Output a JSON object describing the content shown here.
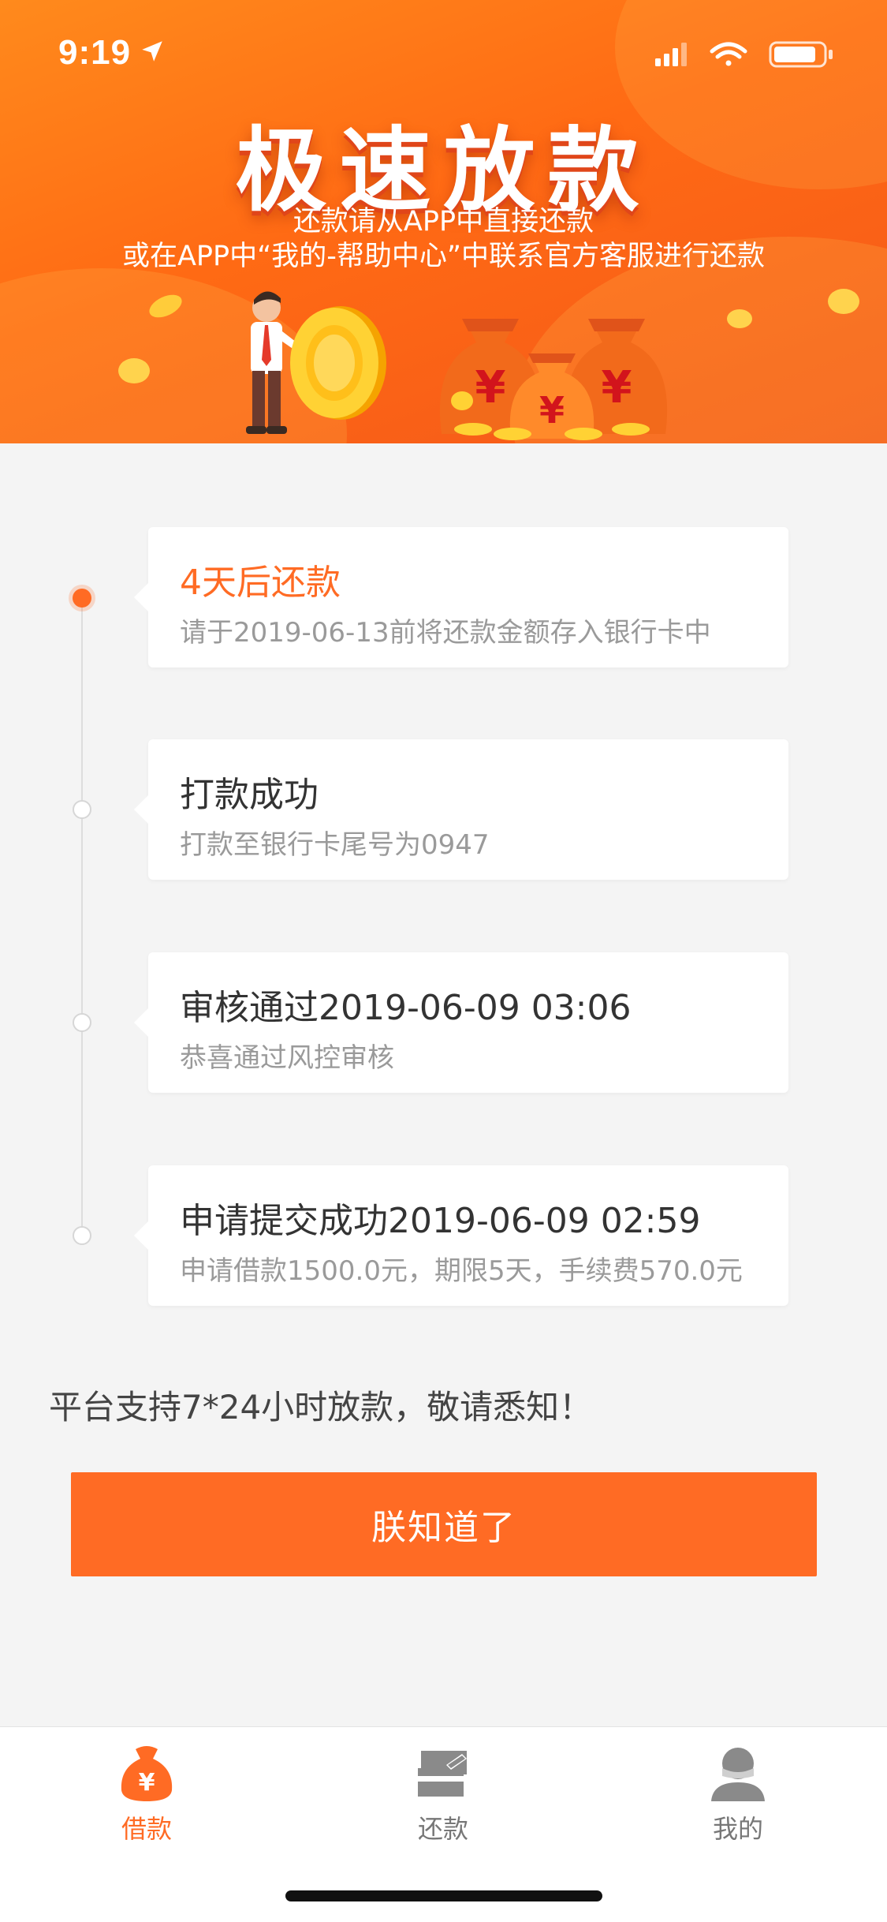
{
  "status_bar": {
    "time": "9:19"
  },
  "banner": {
    "title": "极速放款",
    "subtitle_line1": "还款请从APP中直接还款",
    "subtitle_line2": "或在APP中“我的-帮助中心”中联系官方客服进行还款"
  },
  "timeline": [
    {
      "title": "4天后还款",
      "subtitle": "请于2019-06-13前将还款金额存入银行卡中",
      "active": true
    },
    {
      "title": "打款成功",
      "subtitle": "打款至银行卡尾号为0947",
      "active": false
    },
    {
      "title": "审核通过2019-06-09 03:06",
      "subtitle": "恭喜通过风控审核",
      "active": false
    },
    {
      "title": "申请提交成功2019-06-09 02:59",
      "subtitle": "申请借款1500.0元，期限5天，手续费570.0元",
      "active": false
    }
  ],
  "notice": "平台支持7*24小时放款，敬请悉知！",
  "confirm_button": "朕知道了",
  "tabs": [
    {
      "label": "借款",
      "icon": "money-bag-icon",
      "active": true
    },
    {
      "label": "还款",
      "icon": "card-repay-icon",
      "active": false
    },
    {
      "label": "我的",
      "icon": "user-icon",
      "active": false
    }
  ],
  "colors": {
    "accent": "#ff6b24",
    "banner": "#ff7a1a",
    "background": "#f4f4f4"
  }
}
